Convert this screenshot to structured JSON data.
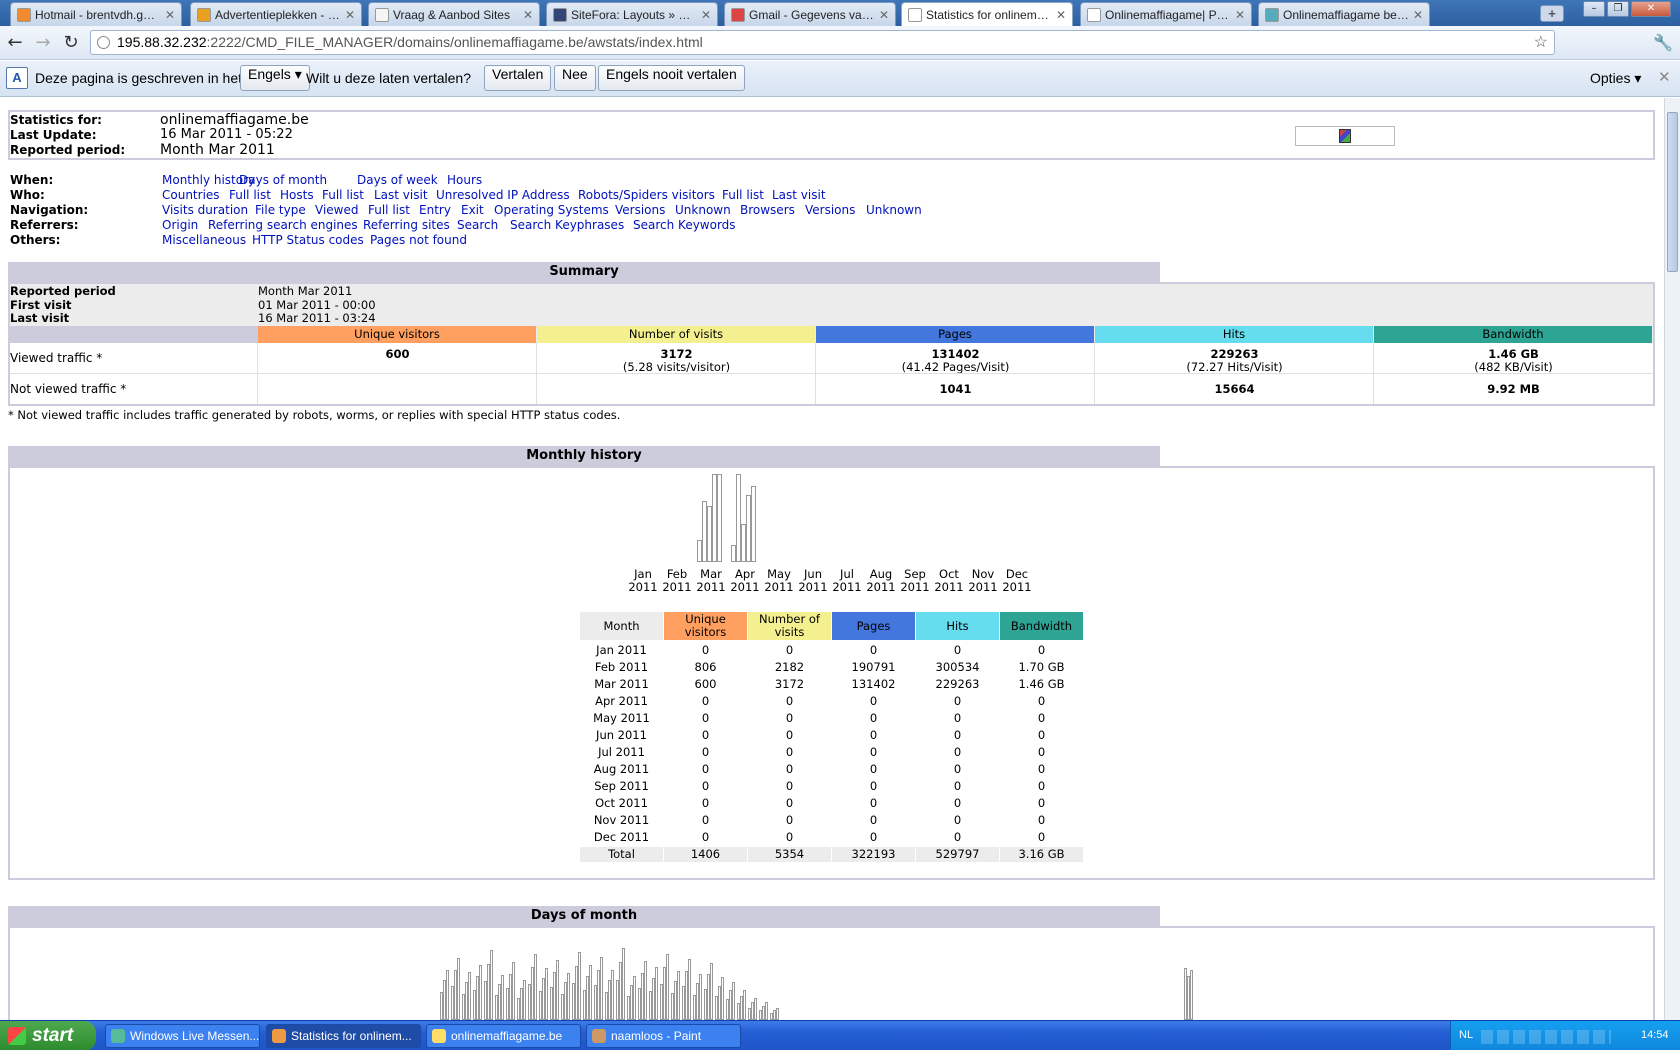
{
  "browser": {
    "tabs": [
      {
        "title": "Hotmail - brentvdh.game...",
        "active": false
      },
      {
        "title": "Advertentieplekken - SiteD...",
        "active": false
      },
      {
        "title": "Vraag & Aanbod Sites",
        "active": false
      },
      {
        "title": "SiteFora: Layouts » Gezoc...",
        "active": false
      },
      {
        "title": "Gmail - Gegevens van uw ...",
        "active": false
      },
      {
        "title": "Statistics for onlinemaffiag...",
        "active": true
      },
      {
        "title": "Onlinemaffiagame| Play th...",
        "active": false
      },
      {
        "title": "Onlinemaffiagame be | Cri...",
        "active": false
      }
    ],
    "url_host": "195.88.32.232",
    "url_rest": ":2222/CMD_FILE_MANAGER/domains/onlinemaffiagame.be/awstats/index.html"
  },
  "translate": {
    "text1": "Deze pagina is geschreven in het",
    "language": "Engels",
    "text2": "Wilt u deze laten vertalen?",
    "btn_translate": "Vertalen",
    "btn_no": "Nee",
    "btn_never": "Engels nooit vertalen",
    "options": "Opties"
  },
  "header": {
    "stats_for_label": "Statistics for:",
    "stats_for_value": "onlinemaffiagame.be",
    "last_update_label": "Last Update:",
    "last_update_value": "16 Mar 2011 - 05:22",
    "period_label": "Reported period:",
    "period_value": "Month Mar 2011"
  },
  "menu": [
    {
      "label": "When:",
      "links": [
        "Monthly history",
        "Days of month",
        "Days of week",
        "Hours"
      ]
    },
    {
      "label": "Who:",
      "links": [
        "Countries",
        "Full list",
        "Hosts",
        "Full list",
        "Last visit",
        "Unresolved IP Address",
        "Robots/Spiders visitors",
        "Full list",
        "Last visit"
      ]
    },
    {
      "label": "Navigation:",
      "links": [
        "Visits duration",
        "File type",
        "Viewed",
        "Full list",
        "Entry",
        "Exit",
        "Operating Systems",
        "Versions",
        "Unknown",
        "Browsers",
        "Versions",
        "Unknown"
      ]
    },
    {
      "label": "Referrers:",
      "links": [
        "Origin",
        "Referring search engines",
        "Referring sites",
        "Search",
        "Search Keyphrases",
        "Search Keywords"
      ]
    },
    {
      "label": "Others:",
      "links": [
        "Miscellaneous",
        "HTTP Status codes",
        "Pages not found"
      ]
    }
  ],
  "summary": {
    "title": "Summary",
    "reported_period_label": "Reported period",
    "reported_period_value": "Month Mar 2011",
    "first_visit_label": "First visit",
    "first_visit_value": "01 Mar 2011 - 00:00",
    "last_visit_label": "Last visit",
    "last_visit_value": "16 Mar 2011 - 03:24",
    "columns": [
      "Unique visitors",
      "Number of visits",
      "Pages",
      "Hits",
      "Bandwidth"
    ],
    "viewed_label": "Viewed traffic *",
    "viewed": [
      {
        "main": "600",
        "sub": ""
      },
      {
        "main": "3172",
        "sub": "(5.28 visits/visitor)"
      },
      {
        "main": "131402",
        "sub": "(41.42 Pages/Visit)"
      },
      {
        "main": "229263",
        "sub": "(72.27 Hits/Visit)"
      },
      {
        "main": "1.46 GB",
        "sub": "(482 KB/Visit)"
      }
    ],
    "not_viewed_label": "Not viewed traffic *",
    "not_viewed": [
      "",
      "",
      "1041",
      "15664",
      "9.92 MB"
    ],
    "footnote": "* Not viewed traffic includes traffic generated by robots, worms, or replies with special HTTP status codes."
  },
  "monthly": {
    "title": "Monthly history",
    "columns": [
      "Month",
      "Unique visitors",
      "Number of visits",
      "Pages",
      "Hits",
      "Bandwidth"
    ],
    "rows": [
      [
        "Jan 2011",
        "0",
        "0",
        "0",
        "0",
        "0"
      ],
      [
        "Feb 2011",
        "806",
        "2182",
        "190791",
        "300534",
        "1.70 GB"
      ],
      [
        "Mar 2011",
        "600",
        "3172",
        "131402",
        "229263",
        "1.46 GB"
      ],
      [
        "Apr 2011",
        "0",
        "0",
        "0",
        "0",
        "0"
      ],
      [
        "May 2011",
        "0",
        "0",
        "0",
        "0",
        "0"
      ],
      [
        "Jun 2011",
        "0",
        "0",
        "0",
        "0",
        "0"
      ],
      [
        "Jul 2011",
        "0",
        "0",
        "0",
        "0",
        "0"
      ],
      [
        "Aug 2011",
        "0",
        "0",
        "0",
        "0",
        "0"
      ],
      [
        "Sep 2011",
        "0",
        "0",
        "0",
        "0",
        "0"
      ],
      [
        "Oct 2011",
        "0",
        "0",
        "0",
        "0",
        "0"
      ],
      [
        "Nov 2011",
        "0",
        "0",
        "0",
        "0",
        "0"
      ],
      [
        "Dec 2011",
        "0",
        "0",
        "0",
        "0",
        "0"
      ]
    ],
    "total": [
      "Total",
      "1406",
      "5354",
      "322193",
      "529797",
      "3.16 GB"
    ]
  },
  "chart_data": {
    "type": "bar",
    "categories": [
      "Jan 2011",
      "Feb 2011",
      "Mar 2011",
      "Apr 2011",
      "May 2011",
      "Jun 2011",
      "Jul 2011",
      "Aug 2011",
      "Sep 2011",
      "Oct 2011",
      "Nov 2011",
      "Dec 2011"
    ],
    "category_labels": [
      [
        "Jan",
        "2011"
      ],
      [
        "Feb",
        "2011"
      ],
      [
        "Mar",
        "2011"
      ],
      [
        "Apr",
        "2011"
      ],
      [
        "May",
        "2011"
      ],
      [
        "Jun",
        "2011"
      ],
      [
        "Jul",
        "2011"
      ],
      [
        "Aug",
        "2011"
      ],
      [
        "Sep",
        "2011"
      ],
      [
        "Oct",
        "2011"
      ],
      [
        "Nov",
        "2011"
      ],
      [
        "Dec",
        "2011"
      ]
    ],
    "series": [
      {
        "values": [
          0,
          806,
          600,
          0,
          0,
          0,
          0,
          0,
          0,
          0,
          0,
          0
        ]
      },
      {
        "values": [
          0,
          2182,
          3172,
          0,
          0,
          0,
          0,
          0,
          0,
          0,
          0,
          0
        ]
      },
      {
        "values": [
          0,
          190791,
          131402,
          0,
          0,
          0,
          0,
          0,
          0,
          0,
          0,
          0
        ]
      },
      {
        "values": [
          0,
          300534,
          229263,
          0,
          0,
          0,
          0,
          0,
          0,
          0,
          0,
          0
        ]
      },
      {
        "values": [
          0,
          1.7,
          1.46,
          0,
          0,
          0,
          0,
          0,
          0,
          0,
          0,
          0
        ]
      }
    ],
    "ylim_fraction": [
      0,
      1
    ],
    "title": "",
    "xlabel": "",
    "ylabel": ""
  },
  "days_of_month": {
    "title": "Days of month"
  },
  "taskbar": {
    "start": "start",
    "items": [
      "Windows Live Messen...",
      "Statistics for onlinem...",
      "onlinemaffiagame.be",
      "naamloos - Paint"
    ],
    "lang": "NL",
    "clock": "14:54"
  }
}
